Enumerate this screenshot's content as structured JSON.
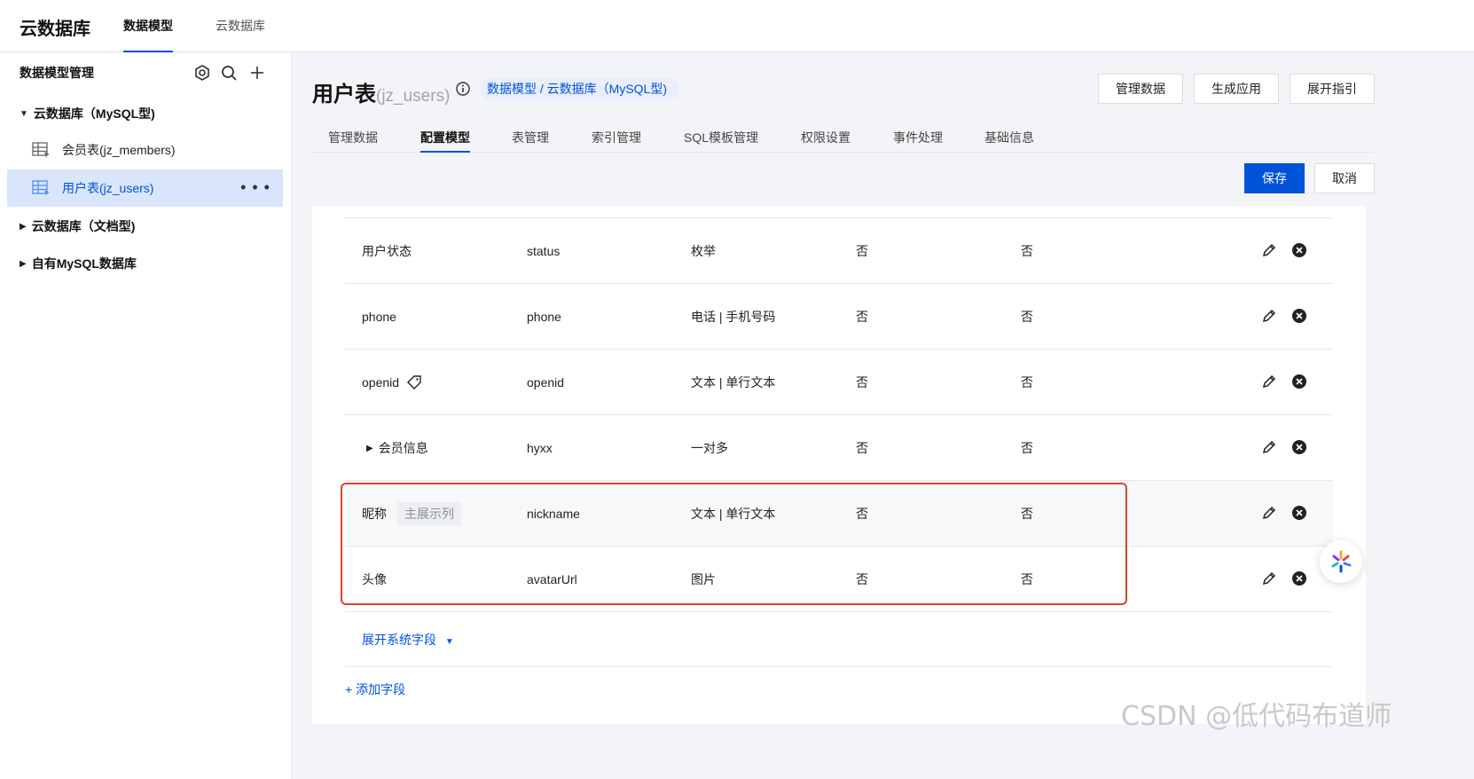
{
  "app": {
    "brand": "云数据库",
    "nav": [
      "数据模型",
      "云数据库"
    ]
  },
  "sidebar": {
    "title": "数据模型管理",
    "groups": [
      {
        "label": "云数据库（MySQL型)",
        "expanded": true,
        "items": [
          {
            "label": "会员表(jz_members)"
          },
          {
            "label": "用户表(jz_users)",
            "active": true
          }
        ]
      },
      {
        "label": "云数据库（文档型)",
        "expanded": false
      },
      {
        "label": "自有MySQL数据库",
        "expanded": false
      }
    ]
  },
  "header": {
    "title": "用户表",
    "subtitle": "(jz_users)",
    "breadcrumb": "数据模型 / 云数据库（MySQL型)",
    "buttons": [
      "管理数据",
      "生成应用",
      "展开指引"
    ]
  },
  "tabs": [
    "管理数据",
    "配置模型",
    "表管理",
    "索引管理",
    "SQL模板管理",
    "权限设置",
    "事件处理",
    "基础信息"
  ],
  "actions": {
    "save": "保存",
    "cancel": "取消"
  },
  "fields": [
    {
      "name": "用户状态",
      "key": "status",
      "type": "枚举",
      "c1": "否",
      "c2": "否"
    },
    {
      "name": "phone",
      "key": "phone",
      "type": "电话 | 手机号码",
      "c1": "否",
      "c2": "否"
    },
    {
      "name": "openid",
      "key": "openid",
      "type": "文本 | 单行文本",
      "c1": "否",
      "c2": "否"
    },
    {
      "name": "会员信息",
      "key": "hyxx",
      "type": "一对多",
      "c1": "否",
      "c2": "否"
    },
    {
      "name": "昵称",
      "tag": "主展示列",
      "key": "nickname",
      "type": "文本 | 单行文本",
      "c1": "否",
      "c2": "否"
    },
    {
      "name": "头像",
      "key": "avatarUrl",
      "type": "图片",
      "c1": "否",
      "c2": "否"
    }
  ],
  "expand_system": "展开系统字段",
  "add_field": "+ 添加字段",
  "watermark": "CSDN @低代码布道师",
  "colors": {
    "primary": "#0052d9",
    "highlight_border": "#d8432c"
  }
}
